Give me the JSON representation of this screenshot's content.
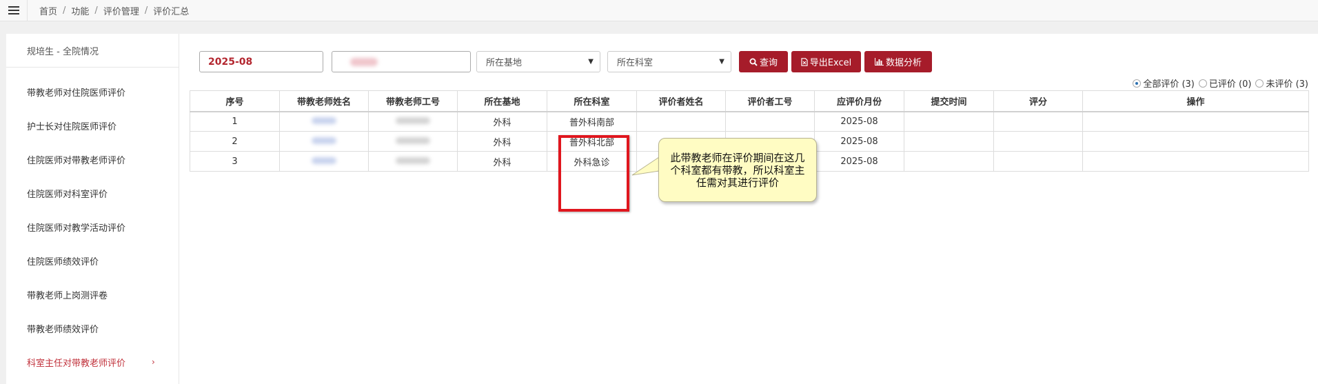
{
  "breadcrumb": {
    "items": [
      "首页",
      "功能",
      "评价管理",
      "评价汇总"
    ],
    "separator": "/"
  },
  "sidebar": {
    "header": "规培生 - 全院情况",
    "items": [
      {
        "label": "带教老师对住院医师评价"
      },
      {
        "label": "护士长对住院医师评价"
      },
      {
        "label": "住院医师对带教老师评价"
      },
      {
        "label": "住院医师对科室评价"
      },
      {
        "label": "住院医师对教学活动评价"
      },
      {
        "label": "住院医师绩效评价"
      },
      {
        "label": "带教老师上岗测评卷"
      },
      {
        "label": "带教老师绩效评价"
      },
      {
        "label": "科室主任对带教老师评价",
        "active": true
      }
    ]
  },
  "toolbar": {
    "month_value": "2025-08",
    "base_select": "所在基地",
    "dept_select": "所在科室",
    "query_label": "查询",
    "export_label": "导出Excel",
    "analysis_label": "数据分析"
  },
  "filters": {
    "all": "全部评价 (3)",
    "done": "已评价 (0)",
    "todo": "未评价 (3)",
    "selected": "all"
  },
  "table": {
    "columns": [
      "序号",
      "带教老师姓名",
      "带教老师工号",
      "所在基地",
      "所在科室",
      "评价者姓名",
      "评价者工号",
      "应评价月份",
      "提交时间",
      "评分",
      "操作"
    ],
    "rows": [
      {
        "no": "1",
        "base": "外科",
        "dept": "普外科南部",
        "month": "2025-08"
      },
      {
        "no": "2",
        "base": "外科",
        "dept": "普外科北部",
        "month": "2025-08"
      },
      {
        "no": "3",
        "base": "外科",
        "dept": "外科急诊",
        "month": "2025-08"
      }
    ]
  },
  "callout": {
    "text": "此带教老师在评价期间在这几个科室都有带教，所以科室主任需对其进行评价"
  },
  "colors": {
    "brand": "#a61c2a",
    "active_text": "#c0303a",
    "highlight_border": "#e0161e",
    "callout_bg": "#fffcc3"
  }
}
